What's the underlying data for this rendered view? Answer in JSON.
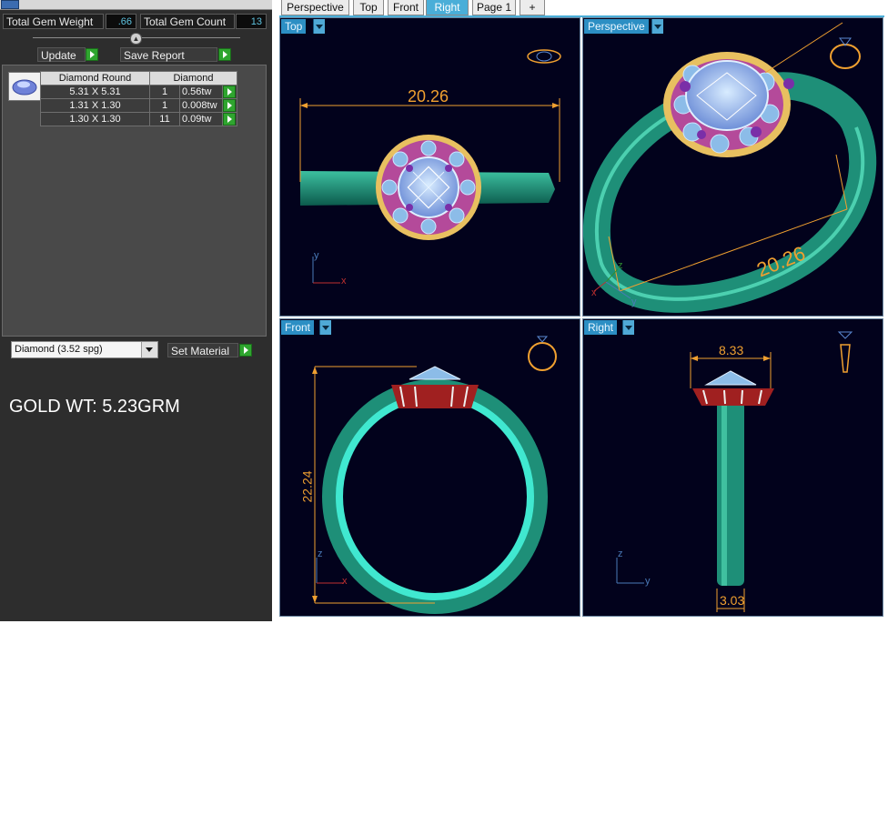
{
  "left_panel": {
    "total_gem_weight_label": "Total Gem Weight",
    "total_gem_weight_value": ".66",
    "total_gem_count_label": "Total Gem Count",
    "total_gem_count_value": "13",
    "update_label": "Update",
    "save_report_label": "Save Report",
    "gem_table": {
      "headers": [
        "Diamond Round",
        "Diamond"
      ],
      "rows": [
        {
          "size": "5.31 X 5.31",
          "count": "1",
          "weight": "0.56tw"
        },
        {
          "size": "1.31 X 1.30",
          "count": "1",
          "weight": "0.008tw"
        },
        {
          "size": "1.30 X 1.30",
          "count": "11",
          "weight": "0.09tw"
        }
      ]
    },
    "material_select_value": "Diamond      (3.52 spg)",
    "set_material_label": "Set Material",
    "gold_weight_text": "GOLD WT: 5.23GRM"
  },
  "tabs": [
    {
      "label": "Perspective",
      "active": false
    },
    {
      "label": "Top",
      "active": false
    },
    {
      "label": "Front",
      "active": false
    },
    {
      "label": "Right",
      "active": true
    },
    {
      "label": "Page 1",
      "active": false
    },
    {
      "label": "+",
      "active": false
    }
  ],
  "viewports": {
    "top": {
      "label": "Top",
      "dimension": "20.26",
      "axis_y": "y",
      "axis_x": "x"
    },
    "perspective": {
      "label": "Perspective",
      "dimension": "20.26",
      "axis_z": "z",
      "axis_x": "x",
      "axis_y": "y"
    },
    "front": {
      "label": "Front",
      "dimension": "22.24",
      "axis_z": "z",
      "axis_x": "x"
    },
    "right": {
      "label": "Right",
      "dimension_top": "8.33",
      "dimension_bottom": "3.03",
      "axis_z": "z",
      "axis_y": "y"
    }
  },
  "colors": {
    "accent": "#4aaed8",
    "go_button": "#2fa52f",
    "stat_value": "#5ec3e0",
    "dimension": "#f0a030",
    "ring_metal": "#1e8f78",
    "gem": "#8fb4f0"
  }
}
